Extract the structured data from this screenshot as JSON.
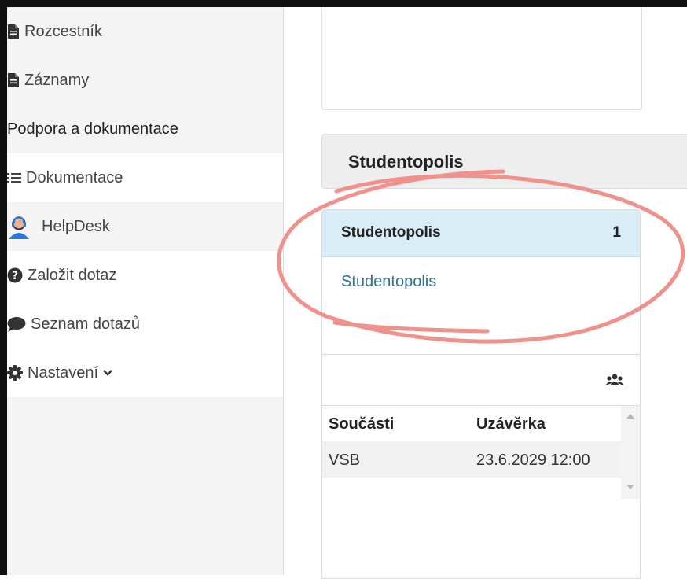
{
  "sidebar": {
    "items": [
      {
        "label": "Rozcestník",
        "icon": "file-icon"
      },
      {
        "label": "Záznamy",
        "icon": "file-icon"
      },
      {
        "label": "Podpora a dokumentace"
      },
      {
        "label": "Dokumentace",
        "icon": "list-icon"
      },
      {
        "label": "HelpDesk",
        "icon": "helpdesk-avatar-icon"
      },
      {
        "label": "Založit dotaz",
        "icon": "question-circle-icon"
      },
      {
        "label": "Seznam dotazů",
        "icon": "comment-icon"
      },
      {
        "label": "Nastavení",
        "icon": "gear-icon"
      }
    ]
  },
  "main": {
    "section_title": "Studentopolis",
    "panel": {
      "header_title": "Studentopolis",
      "header_count": "1",
      "link": "Studentopolis"
    },
    "table": {
      "headers": [
        "Součásti",
        "Uzávěrka"
      ],
      "rows": [
        [
          "VSB",
          "23.6.2029 12:00"
        ]
      ]
    }
  },
  "colors": {
    "panel_header_bg": "#d9edf7",
    "link": "#31708f",
    "annotation": "#f0928c"
  }
}
